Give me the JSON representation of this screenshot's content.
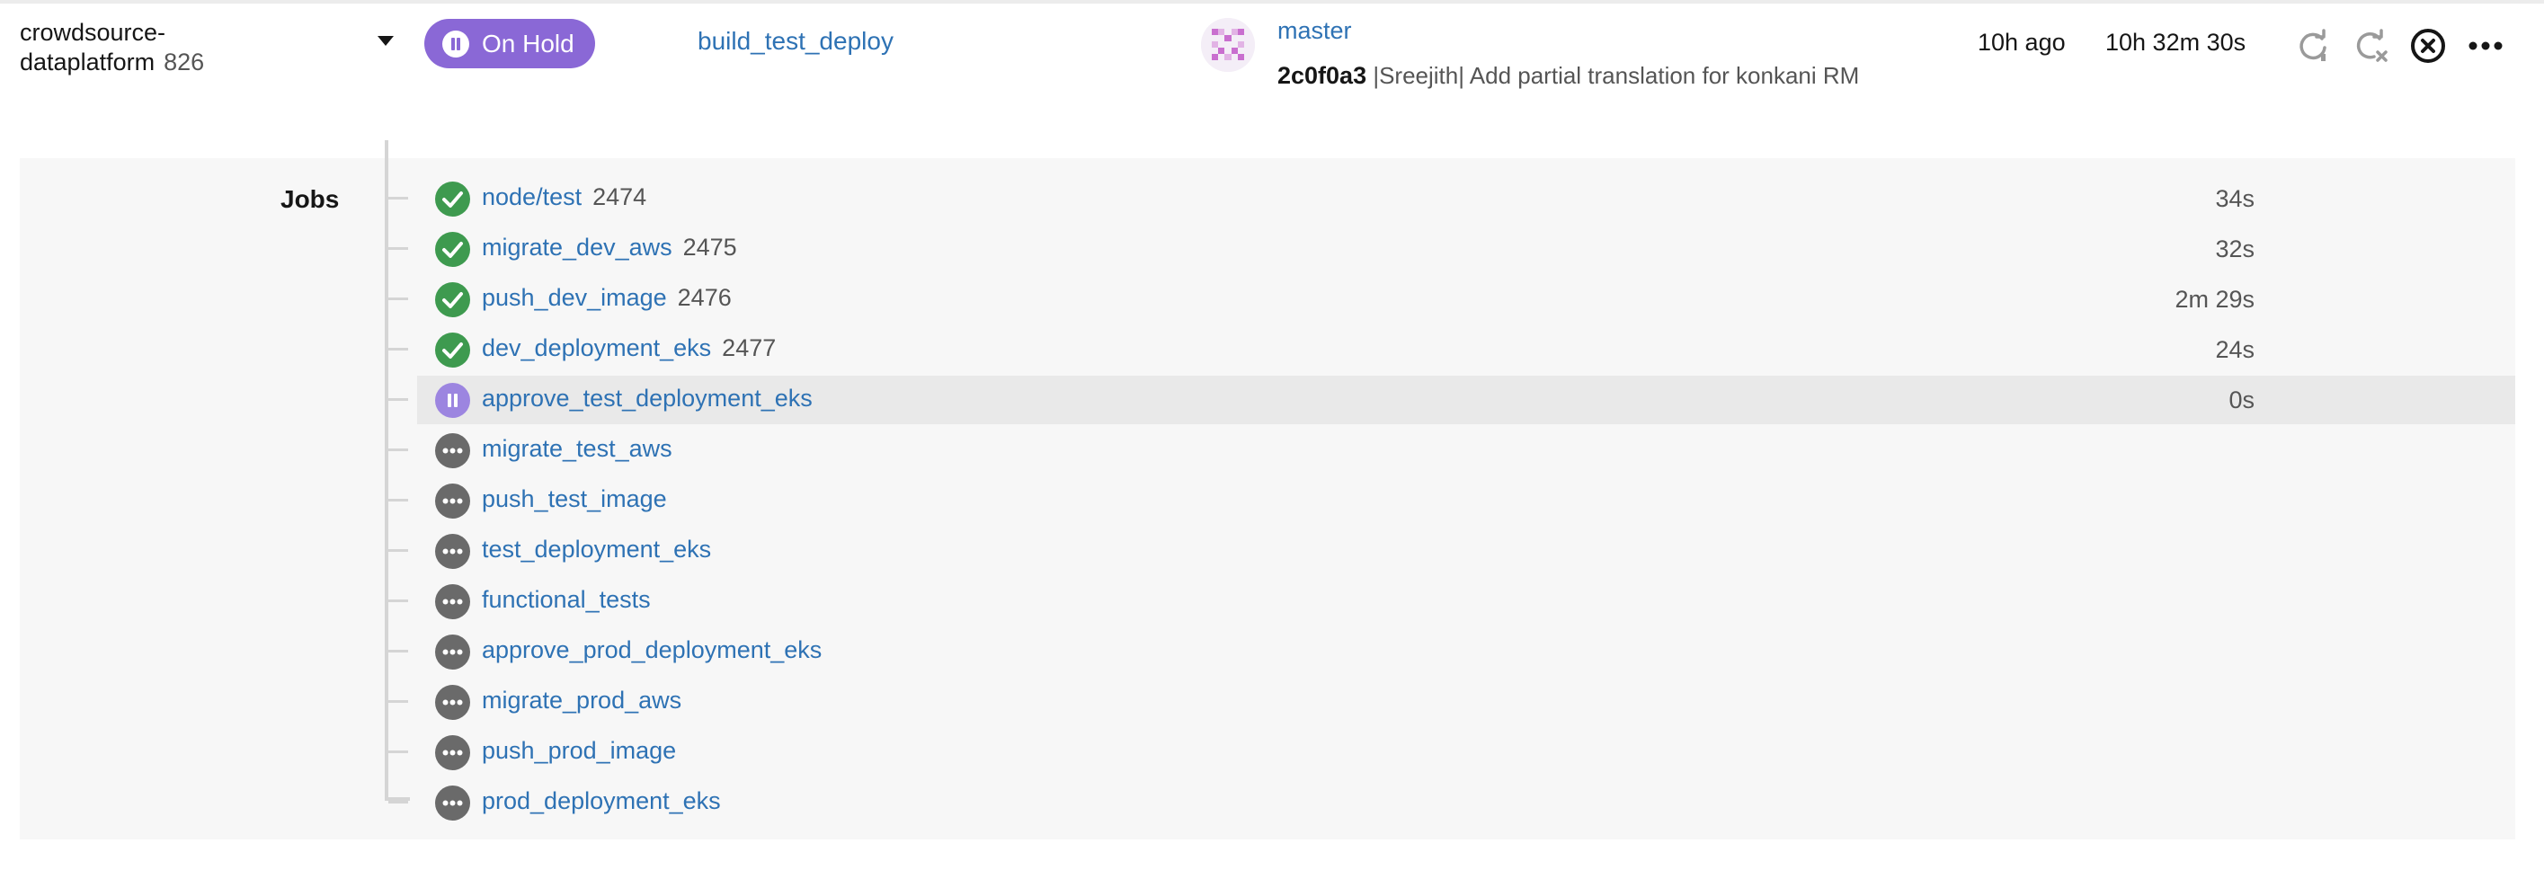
{
  "pipeline": {
    "project": "crowdsource-dataplatform",
    "project_line1": "crowdsource-",
    "project_line2": "dataplatform",
    "number": "826",
    "status": "On Hold",
    "workflow": "build_test_deploy",
    "branch": "master",
    "commit_sha": "2c0f0a3",
    "commit_message": "|Sreejith| Add partial translation for konkani RM",
    "time_ago": "10h ago",
    "duration": "10h 32m 30s",
    "actions": [
      "rerun-icon",
      "rerun-failed-icon",
      "cancel-icon",
      "more-icon"
    ]
  },
  "jobs_section": {
    "label": "Jobs",
    "jobs": [
      {
        "name": "node/test",
        "number": "2474",
        "status": "success",
        "duration": "34s"
      },
      {
        "name": "migrate_dev_aws",
        "number": "2475",
        "status": "success",
        "duration": "32s"
      },
      {
        "name": "push_dev_image",
        "number": "2476",
        "status": "success",
        "duration": "2m 29s"
      },
      {
        "name": "dev_deployment_eks",
        "number": "2477",
        "status": "success",
        "duration": "24s"
      },
      {
        "name": "approve_test_deployment_eks",
        "number": "",
        "status": "on-hold",
        "duration": "0s"
      },
      {
        "name": "migrate_test_aws",
        "number": "",
        "status": "queued",
        "duration": ""
      },
      {
        "name": "push_test_image",
        "number": "",
        "status": "queued",
        "duration": ""
      },
      {
        "name": "test_deployment_eks",
        "number": "",
        "status": "queued",
        "duration": ""
      },
      {
        "name": "functional_tests",
        "number": "",
        "status": "queued",
        "duration": ""
      },
      {
        "name": "approve_prod_deployment_eks",
        "number": "",
        "status": "queued",
        "duration": ""
      },
      {
        "name": "migrate_prod_aws",
        "number": "",
        "status": "queued",
        "duration": ""
      },
      {
        "name": "push_prod_image",
        "number": "",
        "status": "queued",
        "duration": ""
      },
      {
        "name": "prod_deployment_eks",
        "number": "",
        "status": "queued",
        "duration": ""
      }
    ]
  },
  "colors": {
    "link": "#2e72b4",
    "on_hold": "#8a68d6",
    "success": "#3e9a4f",
    "queued": "#6a6a6a",
    "selected_row": "#e9e9e9"
  }
}
